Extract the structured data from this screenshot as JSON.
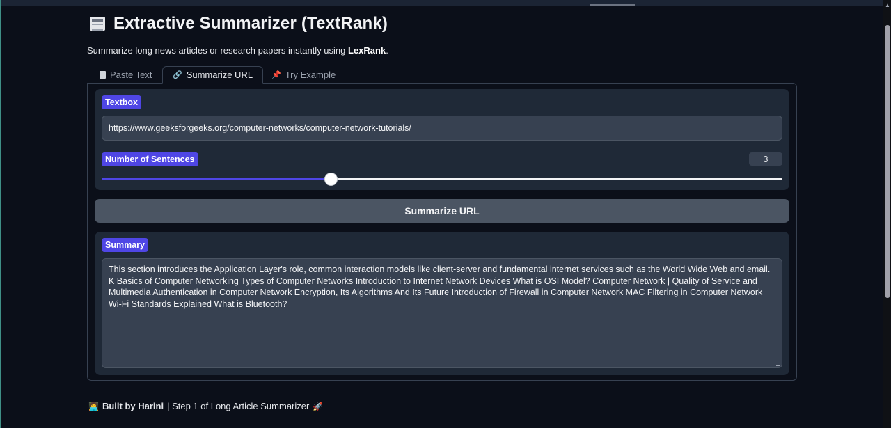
{
  "header": {
    "title": "Extractive Summarizer (TextRank)",
    "subtitle_prefix": "Summarize long news articles or research papers instantly using ",
    "subtitle_bold": "LexRank",
    "subtitle_suffix": "."
  },
  "tabs": [
    {
      "label": "Paste Text",
      "icon": "document-icon",
      "active": false
    },
    {
      "label": "Summarize URL",
      "icon": "link-icon",
      "active": true
    },
    {
      "label": "Try Example",
      "icon": "pushpin-icon",
      "active": false
    }
  ],
  "input": {
    "label": "Textbox",
    "value": "https://www.geeksforgeeks.org/computer-networks/computer-network-tutorials/"
  },
  "slider": {
    "label": "Number of Sentences",
    "value": "3",
    "fraction": 0.336
  },
  "button": {
    "label": "Summarize URL"
  },
  "output": {
    "label": "Summary",
    "text": "This section introduces the Application Layer's role, common interaction models like client-server and fundamental internet services such as the World Wide Web and email. K Basics of Computer Networking Types of Computer Networks Introduction to Internet Network Devices What is OSI Model? Computer Network | Quality of Service and Multimedia Authentication in Computer Network Encryption, Its Algorithms And Its Future Introduction of Firewall in Computer Network MAC Filtering in Computer Network Wi-Fi Standards Explained What is Bluetooth?"
  },
  "footer": {
    "emoji": "👩‍💻",
    "bold": "Built by Harini",
    "rest": " | Step 1 of Long Article Summarizer",
    "emoji_end": "🚀"
  }
}
